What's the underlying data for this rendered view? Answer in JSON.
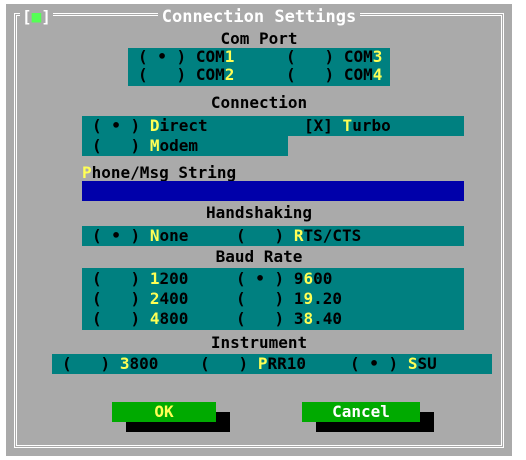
{
  "window": {
    "title": "Connection Settings",
    "close_glyph": "■"
  },
  "comport": {
    "label": "Com Port",
    "options": [
      {
        "mark": "•",
        "pre": "COM",
        "hot": "1",
        "post": "",
        "selected": true
      },
      {
        "mark": " ",
        "pre": "COM",
        "hot": "3",
        "post": "",
        "selected": false
      },
      {
        "mark": " ",
        "pre": "COM",
        "hot": "2",
        "post": "",
        "selected": false
      },
      {
        "mark": " ",
        "pre": "COM",
        "hot": "4",
        "post": "",
        "selected": false
      }
    ]
  },
  "connection": {
    "label": "Connection",
    "direct": {
      "mark": "•",
      "pre": "",
      "hot": "D",
      "post": "irect"
    },
    "modem": {
      "mark": " ",
      "pre": "",
      "hot": "M",
      "post": "odem"
    },
    "turbo": {
      "mark": "X",
      "pre": "",
      "hot": "T",
      "post": "urbo"
    }
  },
  "phone": {
    "hot": "P",
    "rest": "hone/Msg String",
    "value": ""
  },
  "handshaking": {
    "label": "Handshaking",
    "none": {
      "mark": "•",
      "pre": "",
      "hot": "N",
      "post": "one"
    },
    "rtscts": {
      "mark": " ",
      "pre": "",
      "hot": "R",
      "post": "TS/CTS"
    }
  },
  "baud": {
    "label": "Baud Rate",
    "options": [
      {
        "mark": " ",
        "pre": "",
        "hot": "1",
        "post": "200"
      },
      {
        "mark": "•",
        "pre": "9",
        "hot": "6",
        "post": "00"
      },
      {
        "mark": " ",
        "pre": "",
        "hot": "2",
        "post": "400"
      },
      {
        "mark": " ",
        "pre": "1",
        "hot": "9",
        "post": ".20"
      },
      {
        "mark": " ",
        "pre": "",
        "hot": "4",
        "post": "800"
      },
      {
        "mark": " ",
        "pre": "3",
        "hot": "8",
        "post": ".40"
      }
    ]
  },
  "instrument": {
    "label": "Instrument",
    "options": [
      {
        "mark": " ",
        "pre": "",
        "hot": "3",
        "post": "800"
      },
      {
        "mark": " ",
        "pre": "",
        "hot": "P",
        "post": "RR10"
      },
      {
        "mark": "•",
        "pre": "",
        "hot": "S",
        "post": "SU"
      }
    ]
  },
  "buttons": {
    "ok": "OK",
    "cancel": "Cancel"
  },
  "colors": {
    "dialog": "#aaaaaa",
    "panel": "#008080",
    "hotkey": "#ffff55",
    "input": "#0000aa",
    "button": "#00aa00",
    "text": "#000000"
  }
}
